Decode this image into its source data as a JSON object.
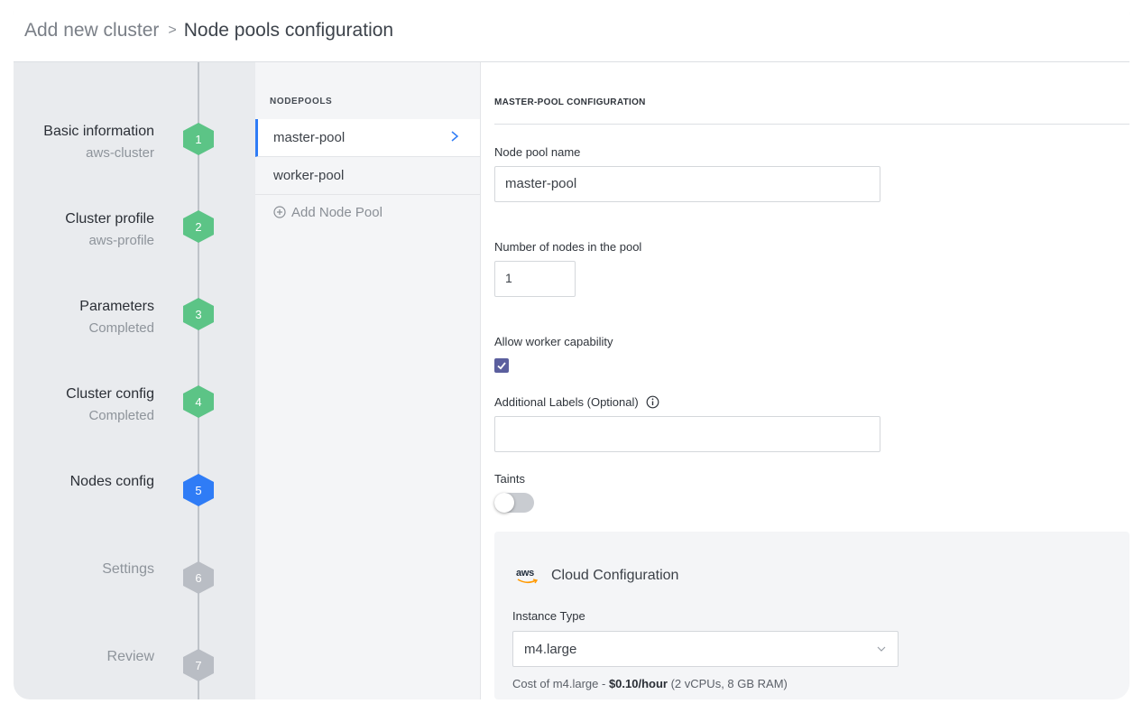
{
  "breadcrumb": {
    "parent": "Add new cluster",
    "separator": ">",
    "current": "Node pools configuration"
  },
  "steps": [
    {
      "number": "1",
      "title": "Basic information",
      "subtitle": "aws-cluster",
      "status": "done"
    },
    {
      "number": "2",
      "title": "Cluster profile",
      "subtitle": "aws-profile",
      "status": "done"
    },
    {
      "number": "3",
      "title": "Parameters",
      "subtitle": "Completed",
      "status": "done"
    },
    {
      "number": "4",
      "title": "Cluster config",
      "subtitle": "Completed",
      "status": "done"
    },
    {
      "number": "5",
      "title": "Nodes config",
      "subtitle": "",
      "status": "active"
    },
    {
      "number": "6",
      "title": "Settings",
      "subtitle": "",
      "status": "pending"
    },
    {
      "number": "7",
      "title": "Review",
      "subtitle": "",
      "status": "pending"
    }
  ],
  "nodepools": {
    "heading": "NODEPOOLS",
    "items": [
      {
        "label": "master-pool",
        "selected": true
      },
      {
        "label": "worker-pool",
        "selected": false
      }
    ],
    "add_label": "Add Node Pool"
  },
  "config": {
    "heading": "MASTER-POOL CONFIGURATION",
    "pool_name_label": "Node pool name",
    "pool_name_value": "master-pool",
    "node_count_label": "Number of nodes in the pool",
    "node_count_value": "1",
    "worker_label": "Allow worker capability",
    "worker_checked": true,
    "labels_label": "Additional Labels (Optional)",
    "labels_value": "",
    "taints_label": "Taints",
    "taints_enabled": false
  },
  "cloud": {
    "logo_text": "aws",
    "title": "Cloud Configuration",
    "instance_label": "Instance Type",
    "instance_value": "m4.large",
    "cost_prefix": "Cost of m4.large - ",
    "cost_price": "$0.10/hour",
    "cost_suffix": " (2 vCPUs, 8 GB RAM)"
  },
  "colors": {
    "accent": "#2f7cf6",
    "step_done": "#5cc486",
    "step_pending": "#b9bdc4",
    "checkbox": "#5b5f9e"
  }
}
